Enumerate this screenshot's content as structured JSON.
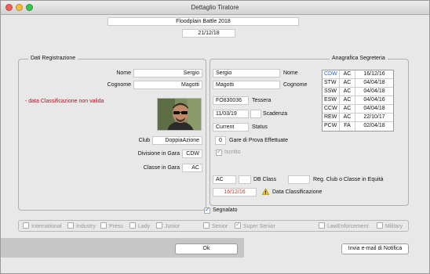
{
  "window": {
    "title": "Dettaglio Tiratore"
  },
  "event": {
    "name": "Floodplain Battle 2018",
    "date": "21/12/18"
  },
  "registration": {
    "title": "Dati Registrazione",
    "nome_label": "Nome",
    "nome": "Sergio",
    "cognome_label": "Cognome",
    "cognome": "Magotti",
    "warning": "- data Classificazione non valida",
    "club_label": "Club",
    "club": "DoppiaAzione",
    "division_label": "Divisione in Gara",
    "division": "CDW",
    "class_label": "Classe in Gara",
    "class": "AC"
  },
  "registry": {
    "title": "Anagrafica Segreteria",
    "nome": "Sergio",
    "nome_label": "Nome",
    "cognome": "Magotti",
    "cognome_label": "Cognome",
    "tessera": "FO830036",
    "tessera_label": "Tessera",
    "scadenza": "11/03/19",
    "scadenza_label": "Scadenza",
    "status": "Current",
    "status_label": "Status",
    "gare": "0",
    "gare_label": "Gare di Prova Effettuate",
    "iscritto_label": "Iscritto",
    "db_class_value": "AC",
    "db_class_label": "DB Class",
    "reg_club_label": "Reg. Club o Classe in Equità",
    "data_class": "16/12/16",
    "data_class_label": "Data Classificazione",
    "classifications": [
      {
        "div": "CDW",
        "cls": "AC",
        "date": "16/12/16"
      },
      {
        "div": "STW",
        "cls": "AC",
        "date": "04/04/18"
      },
      {
        "div": "SSW",
        "cls": "AC",
        "date": "04/04/18"
      },
      {
        "div": "ESW",
        "cls": "AC",
        "date": "04/04/16"
      },
      {
        "div": "CCW",
        "cls": "AC",
        "date": "04/04/18"
      },
      {
        "div": "REW",
        "cls": "AC",
        "date": "22/10/17"
      },
      {
        "div": "PCW",
        "cls": "FA",
        "date": "02/04/18"
      }
    ]
  },
  "segnalato_label": "Segnalato",
  "categories": {
    "international": "International",
    "industry": "Industry",
    "press": "Press",
    "lady": "Lady",
    "junior": "Junior",
    "senior": "Senior",
    "super_senior": "Super Senior",
    "law": "LawEnforcement",
    "military": "Military"
  },
  "buttons": {
    "ok": "Ok",
    "email": "Invia e-mail di Notifica"
  },
  "colors": {
    "warning_red": "#d0021b",
    "accent_blue": "#2b5fcf",
    "date_red": "#c0392b"
  }
}
